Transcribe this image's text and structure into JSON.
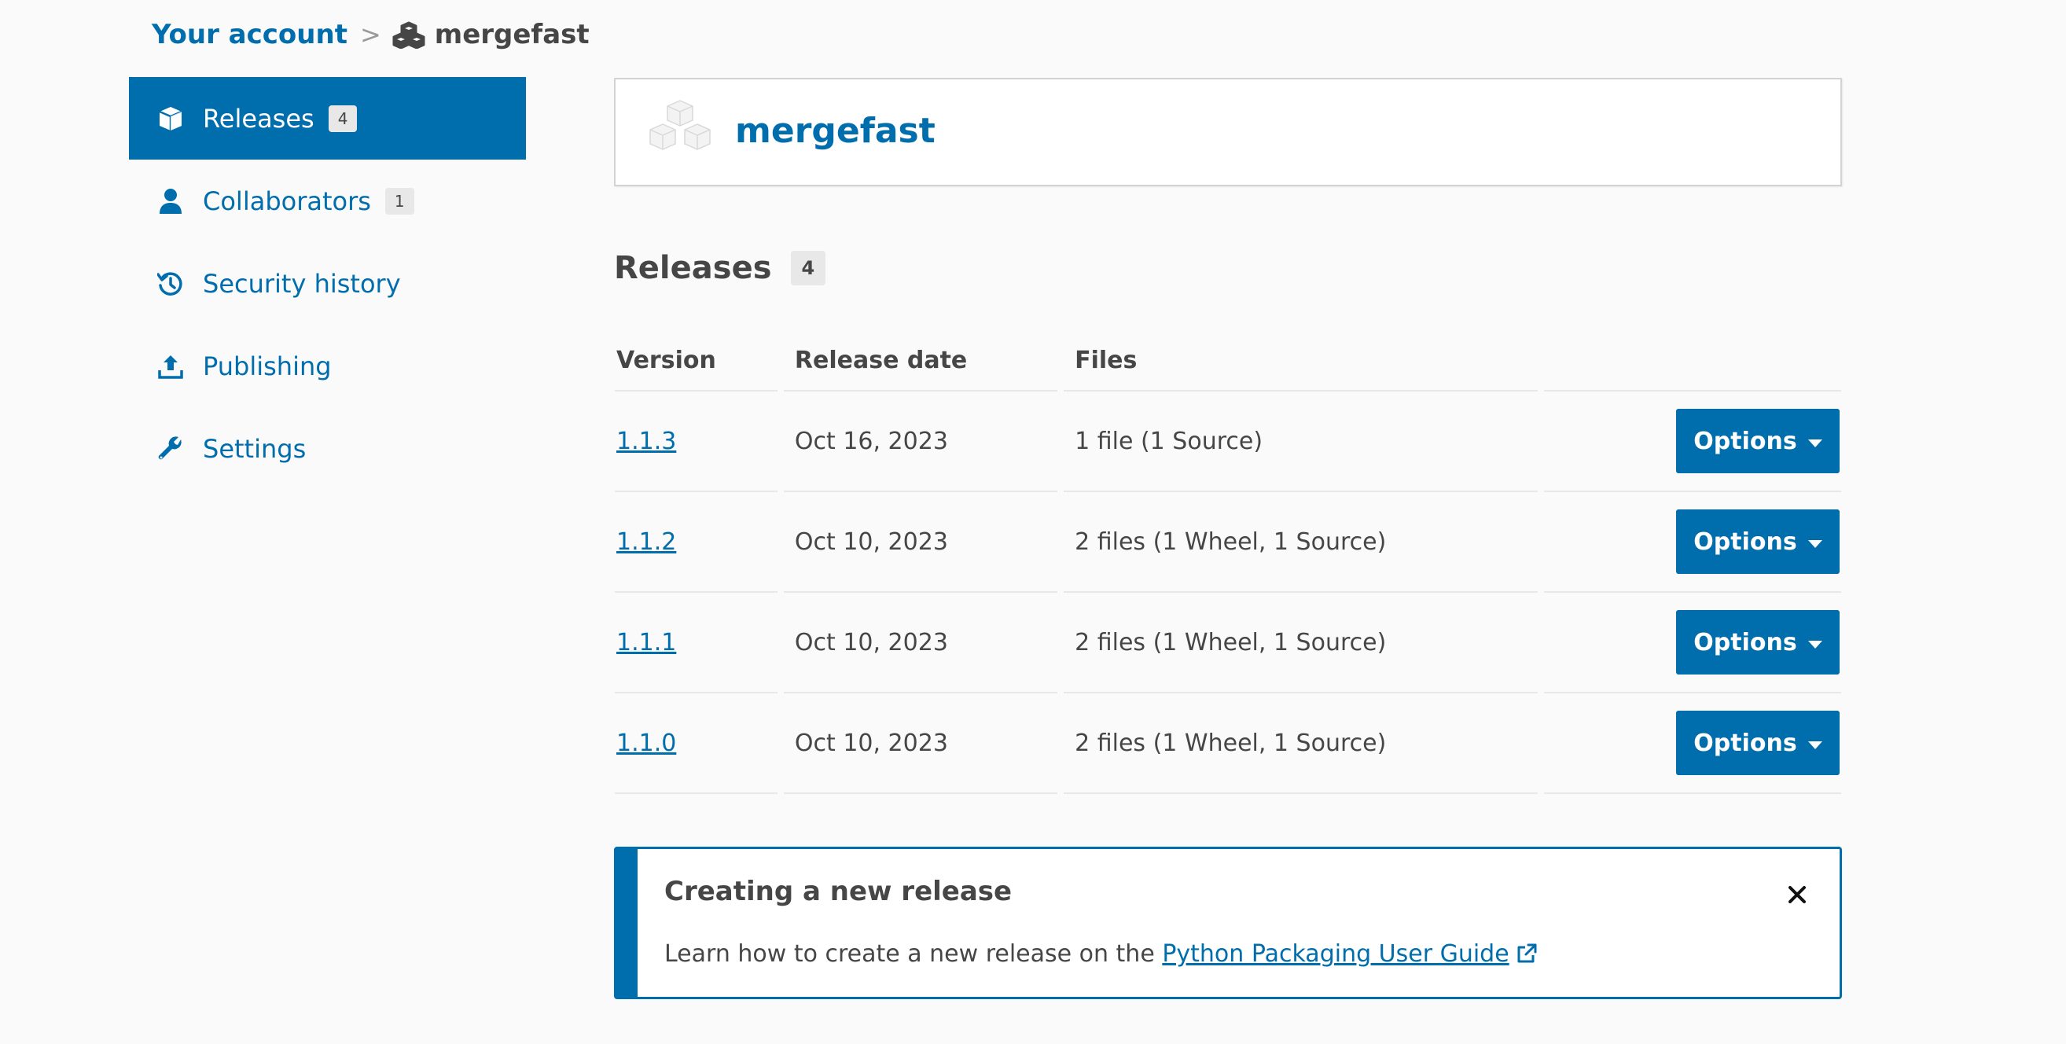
{
  "breadcrumb": {
    "account_label": "Your account",
    "separator": ">",
    "project_label": "mergefast",
    "project_icon": "cubes-icon"
  },
  "sidebar": {
    "items": [
      {
        "label": "Releases",
        "badge": "4",
        "icon": "box-icon",
        "active": true
      },
      {
        "label": "Collaborators",
        "badge": "1",
        "icon": "user-icon",
        "active": false
      },
      {
        "label": "Security history",
        "badge": null,
        "icon": "history-icon",
        "active": false
      },
      {
        "label": "Publishing",
        "badge": null,
        "icon": "upload-icon",
        "active": false
      },
      {
        "label": "Settings",
        "badge": null,
        "icon": "wrench-icon",
        "active": false
      }
    ]
  },
  "project": {
    "name": "mergefast",
    "logo_icon": "cubes-logo-icon"
  },
  "releases": {
    "heading": "Releases",
    "count": "4",
    "columns": {
      "version": "Version",
      "date": "Release date",
      "files": "Files"
    },
    "rows": [
      {
        "version": "1.1.3",
        "date": "Oct 16, 2023",
        "files": "1 file (1 Source)",
        "button": "Options"
      },
      {
        "version": "1.1.2",
        "date": "Oct 10, 2023",
        "files": "2 files (1 Wheel, 1 Source)",
        "button": "Options"
      },
      {
        "version": "1.1.1",
        "date": "Oct 10, 2023",
        "files": "2 files (1 Wheel, 1 Source)",
        "button": "Options"
      },
      {
        "version": "1.1.0",
        "date": "Oct 10, 2023",
        "files": "2 files (1 Wheel, 1 Source)",
        "button": "Options"
      }
    ]
  },
  "callout": {
    "title": "Creating a new release",
    "body_prefix": "Learn how to create a new release on the ",
    "link_text": "Python Packaging User Guide",
    "close_icon": "close-icon",
    "external_icon": "external-link-icon"
  },
  "colors": {
    "accent": "#006dad",
    "text": "#464646",
    "background": "#fafafa",
    "badge_bg": "#e8e8e8"
  }
}
